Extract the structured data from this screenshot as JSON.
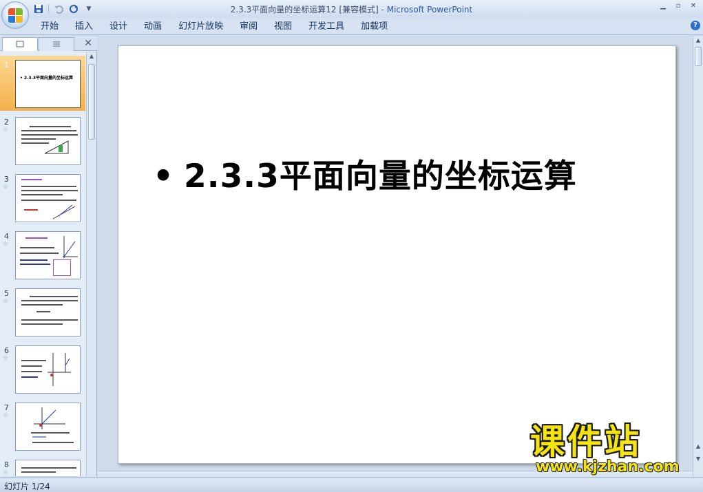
{
  "window": {
    "title": "2.3.3平面向量的坐标运算12 [兼容模式] - ",
    "app_name": "Microsoft PowerPoint"
  },
  "quick_access": {
    "save_icon": "save-icon",
    "undo_icon": "undo-icon",
    "redo_icon": "redo-icon",
    "customize_icon": "dropdown-icon"
  },
  "ribbon": {
    "tabs": [
      "开始",
      "插入",
      "设计",
      "动画",
      "幻灯片放映",
      "审阅",
      "视图",
      "开发工具",
      "加载项"
    ]
  },
  "left_panel": {
    "close_label": "✕",
    "thumbnails": [
      {
        "number": "1",
        "title": "• 2.3.3平面向量的坐标运算",
        "selected": true
      },
      {
        "number": "2",
        "selected": false
      },
      {
        "number": "3",
        "selected": false
      },
      {
        "number": "4",
        "selected": false
      },
      {
        "number": "5",
        "selected": false
      },
      {
        "number": "6",
        "selected": false
      },
      {
        "number": "7",
        "selected": false
      },
      {
        "number": "8",
        "selected": false
      }
    ]
  },
  "slide": {
    "bullet": "•",
    "title": "2.3.3平面向量的坐标运算"
  },
  "status_bar": {
    "slide_info": "幻灯片 1/24"
  },
  "watermark": {
    "main": "课件站",
    "url": "www.kjzhan.com"
  },
  "colors": {
    "accent": "#2a57a7",
    "selected_thumb": "#f5b04c",
    "watermark": "#f5e414"
  }
}
